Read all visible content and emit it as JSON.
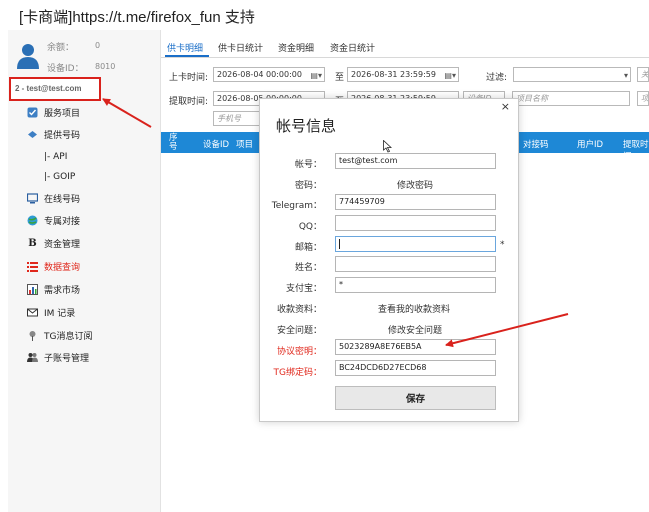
{
  "window": {
    "title": "[卡商端]https://t.me/firefox_fun 支持"
  },
  "sidebar": {
    "balance_label": "余额：",
    "balance_value": "0",
    "device_id_label": "设备ID：",
    "device_id_value": "8010",
    "user_badge": "2 - test@test.com",
    "items": [
      {
        "label": "服务项目",
        "icon": "check-icon"
      },
      {
        "label": "提供号码",
        "icon": "arrow-icon"
      },
      {
        "label": "|- API",
        "icon": ""
      },
      {
        "label": "|- GOIP",
        "icon": ""
      },
      {
        "label": "在线号码",
        "icon": "monitor-icon"
      },
      {
        "label": "专属对接",
        "icon": "globe-icon"
      },
      {
        "label": "资金管理",
        "icon": "b-icon"
      },
      {
        "label": "数据查询",
        "icon": "list-icon"
      },
      {
        "label": "需求市场",
        "icon": "chart-icon"
      },
      {
        "label": "IM 记录",
        "icon": "mail-icon"
      },
      {
        "label": "TG消息订阅",
        "icon": "pin-icon"
      },
      {
        "label": "子账号管理",
        "icon": "people-icon"
      }
    ]
  },
  "tabs": [
    {
      "label": "供卡明细"
    },
    {
      "label": "供卡日统计"
    },
    {
      "label": "资金明细"
    },
    {
      "label": "资金日统计"
    }
  ],
  "filters": {
    "card_time_label": "上卡时间:",
    "card_time_start": "2026-08-04 00:00:00",
    "to_label": "至",
    "card_time_end": "2026-08-31 23:59:59",
    "filter_label": "过滤:",
    "keyword_placeholder": "关",
    "pickup_time_label": "提取时间:",
    "pickup_time_start": "2026-08-05 00:00:00",
    "pickup_time_end": "2026-08-31 23:59:59",
    "device_placeholder": "设备ID",
    "project_placeholder": "项目名称",
    "item_placeholder": "项",
    "phone_placeholder": "手机号"
  },
  "table": {
    "columns": [
      "序号",
      "设备ID",
      "项目",
      "对接码",
      "用户ID",
      "提取时间"
    ]
  },
  "modal": {
    "title": "帐号信息",
    "close": "×",
    "fields": {
      "account_label": "帐号：",
      "account_value": "test@test.com",
      "password_label": "密码：",
      "password_link": "修改密码",
      "telegram_label": "Telegram：",
      "telegram_value": "774459709",
      "qq_label": "QQ：",
      "qq_value": "",
      "email_label": "邮箱：",
      "email_value": "",
      "email_required": "*",
      "name_label": "姓名：",
      "name_value": "",
      "alipay_label": "支付宝：",
      "alipay_value": "*",
      "payment_label": "收款资料：",
      "payment_link": "查看我的收款资料",
      "security_label": "安全问题：",
      "security_link": "修改安全问题",
      "protocol_key_label": "协议密明：",
      "protocol_key_value": "5023289A8E76EB5A",
      "tg_bind_label": "TG绑定码：",
      "tg_bind_value": "BC24DCD6D27ECD68"
    },
    "save_label": "保存"
  },
  "colors": {
    "accent": "#1e88d6",
    "highlight": "#e0281c"
  }
}
